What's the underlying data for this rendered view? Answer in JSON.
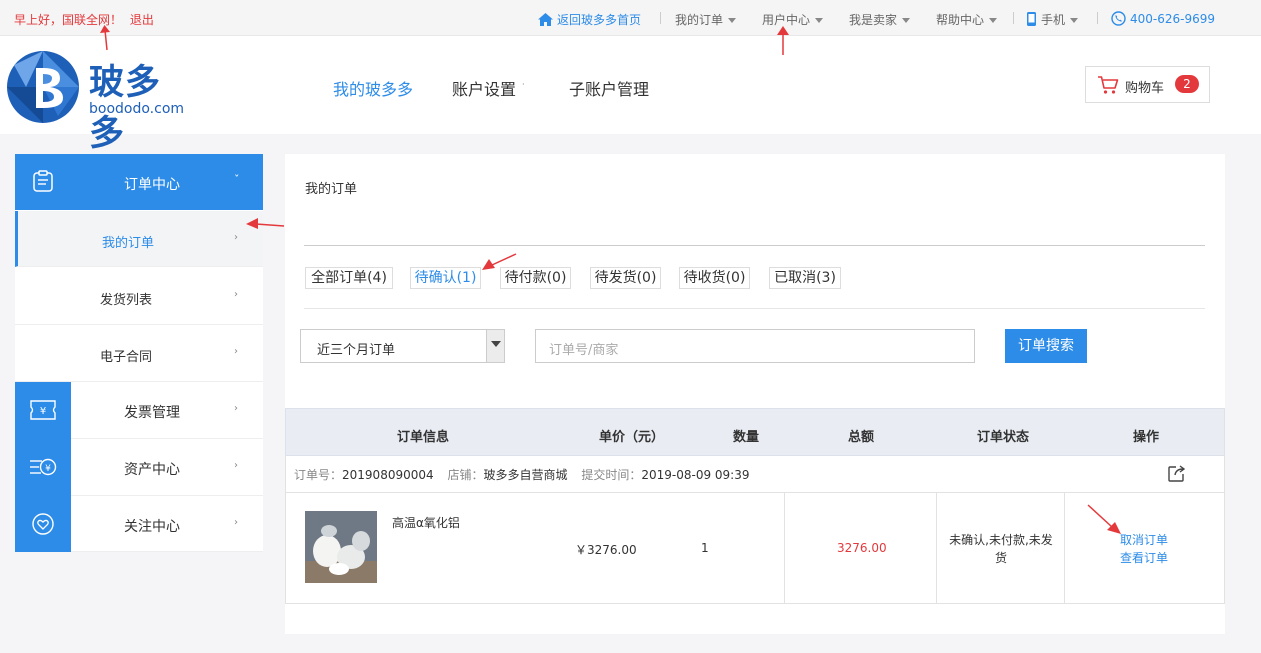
{
  "topbar": {
    "greeting": "早上好，",
    "username": "国联全网",
    "bang": "！",
    "logout": "退出",
    "links": [
      "返回玻多多首页",
      "我的订单",
      "用户中心",
      "我是卖家",
      "帮助中心",
      "手机",
      "400-626-9699"
    ]
  },
  "header": {
    "logo_cn": "玻多多",
    "logo_en": "boododo.com",
    "nav": [
      "我的玻多多",
      "账户设置",
      "子账户管理"
    ],
    "cart_label": "购物车",
    "cart_count": "2"
  },
  "sidebar": {
    "order_center": "订单中心",
    "sub_items": [
      "我的订单",
      "发货列表",
      "电子合同"
    ],
    "groups": [
      "发票管理",
      "资产中心",
      "关注中心"
    ]
  },
  "main": {
    "title": "我的订单",
    "tabs": [
      "全部订单(4)",
      "待确认(1)",
      "待付款(0)",
      "待发货(0)",
      "待收货(0)",
      "已取消(3)"
    ],
    "active_tab": "待确认(1)",
    "period_select": "近三个月订单",
    "search_placeholder": "订单号/商家",
    "search_button": "订单搜索"
  },
  "table": {
    "headers": [
      "订单信息",
      "单价（元）",
      "数量",
      "总额",
      "订单状态",
      "操作"
    ],
    "order_no_label": "订单号：",
    "order_no": "201908090004",
    "shop_label": "店铺：",
    "shop": "玻多多自营商城",
    "time_label": "提交时间：",
    "time": "2019-08-09 09:39",
    "product_name": "高温α氧化铝",
    "unit_price": "￥3276.00",
    "quantity": "1",
    "total": "3276.00",
    "status": "未确认,未付款,未发货",
    "actions": [
      "取消订单",
      "查看订单"
    ]
  },
  "colors": {
    "accent": "#2d8ce8",
    "red": "#e4393c",
    "total_red": "#e4393c"
  }
}
